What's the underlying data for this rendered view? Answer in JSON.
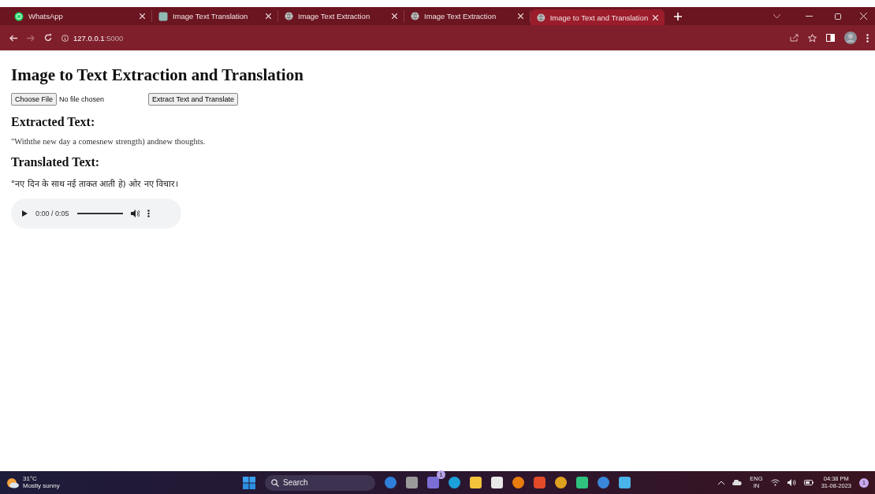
{
  "browser": {
    "tabs": [
      {
        "title": "WhatsApp",
        "selected": false
      },
      {
        "title": "Image Text Translation",
        "selected": false
      },
      {
        "title": "Image Text Extraction",
        "selected": false
      },
      {
        "title": "Image Text Extraction",
        "selected": false
      },
      {
        "title": "Image to Text and Translation",
        "selected": true
      }
    ],
    "address": {
      "host": "127.0.0.1",
      "port": ":5000"
    }
  },
  "page": {
    "title": "Image to Text Extraction and Translation",
    "file_input": {
      "button": "Choose File",
      "status": "No file chosen"
    },
    "submit_button": "Extract Text and Translate",
    "sections": [
      {
        "heading": "Extracted Text:",
        "text": "\"Withthe new day a comesnew strength) andnew thoughts."
      },
      {
        "heading": "Translated Text:",
        "text": "\"नए दिन के साथ नई ताकत आती हे) ओर नए विचार।"
      }
    ],
    "audio": {
      "time": "0:00 / 0:05"
    }
  },
  "taskbar": {
    "weather": {
      "temp": "31°C",
      "condition": "Mostly sunny"
    },
    "search": "Search",
    "apps": [
      {
        "kind": "copilot",
        "color": "#2f7fd8"
      },
      {
        "kind": "taskview",
        "color": "#9a9a9a"
      },
      {
        "kind": "teams",
        "color": "#7b6fd6",
        "badge": "1"
      },
      {
        "kind": "edge",
        "color": "#1ba0d8"
      },
      {
        "kind": "folder",
        "color": "#f3c33c"
      },
      {
        "kind": "store",
        "color": "#e8e8e8"
      },
      {
        "kind": "blender",
        "color": "#e87d0d"
      },
      {
        "kind": "brave",
        "color": "#e24a2a"
      },
      {
        "kind": "chrome",
        "color": "#e0a020"
      },
      {
        "kind": "pycharm",
        "color": "#2ec27e"
      },
      {
        "kind": "chrome",
        "color": "#3a86d8"
      },
      {
        "kind": "notepad",
        "color": "#4ab3e8"
      }
    ],
    "tray": {
      "lang": "ENG",
      "region": "IN",
      "time": "04:38 PM",
      "date": "31-08-2023",
      "notifications": "1"
    }
  }
}
